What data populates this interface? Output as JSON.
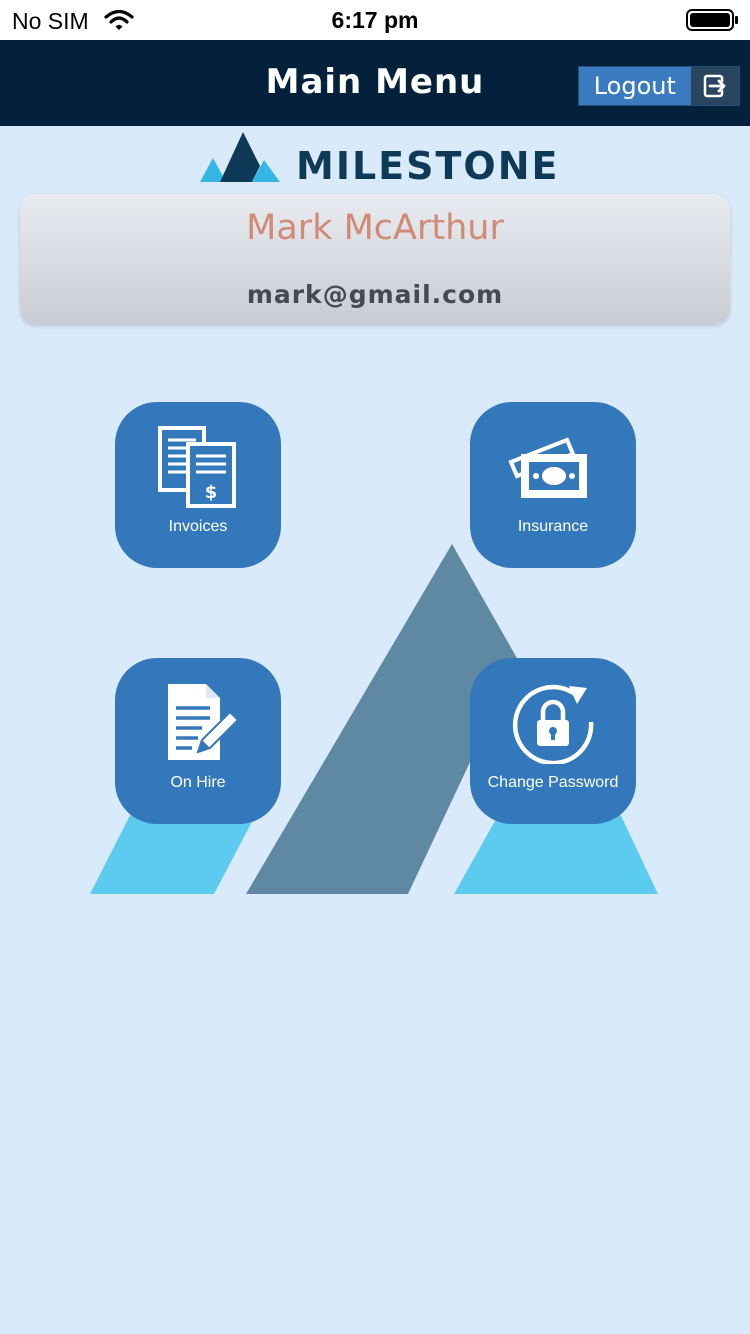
{
  "status_bar": {
    "carrier": "No SIM",
    "time": "6:17 pm"
  },
  "header": {
    "title": "Main Menu",
    "logout_label": "Logout"
  },
  "logo": {
    "text": "MILESTONE"
  },
  "profile": {
    "name": "Mark McArthur",
    "email": "mark@gmail.com"
  },
  "menu": {
    "items": [
      {
        "label": "Invoices",
        "icon": "invoices-icon"
      },
      {
        "label": "Insurance",
        "icon": "cash-icon"
      },
      {
        "label": "On Hire",
        "icon": "document-edit-icon"
      },
      {
        "label": "Change Password",
        "icon": "lock-refresh-icon"
      }
    ]
  },
  "colors": {
    "nav_background": "#03213a",
    "page_background": "#d9eafb",
    "tile_background": "#3478bc",
    "accent_light": "#5ccbf0",
    "name_color": "#d18b75"
  }
}
